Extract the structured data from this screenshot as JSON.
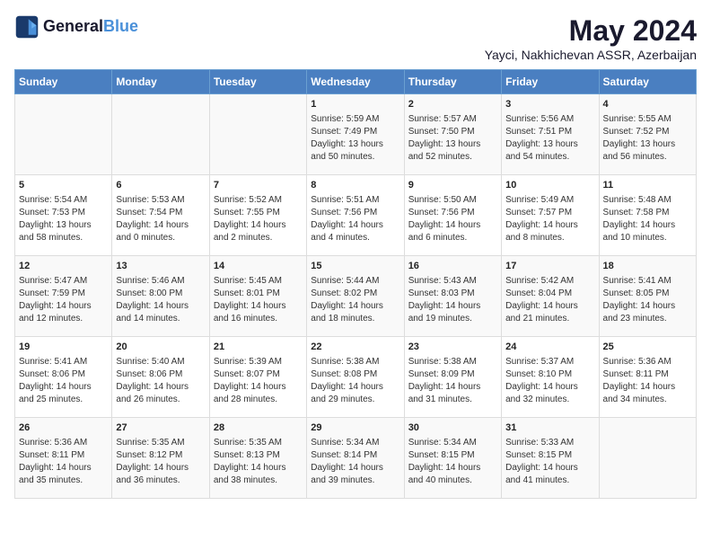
{
  "header": {
    "logo_line1": "General",
    "logo_line2": "Blue",
    "month_title": "May 2024",
    "location": "Yayci, Nakhichevan ASSR, Azerbaijan"
  },
  "days_of_week": [
    "Sunday",
    "Monday",
    "Tuesday",
    "Wednesday",
    "Thursday",
    "Friday",
    "Saturday"
  ],
  "weeks": [
    [
      {
        "day": "",
        "info": ""
      },
      {
        "day": "",
        "info": ""
      },
      {
        "day": "",
        "info": ""
      },
      {
        "day": "1",
        "info": "Sunrise: 5:59 AM\nSunset: 7:49 PM\nDaylight: 13 hours\nand 50 minutes."
      },
      {
        "day": "2",
        "info": "Sunrise: 5:57 AM\nSunset: 7:50 PM\nDaylight: 13 hours\nand 52 minutes."
      },
      {
        "day": "3",
        "info": "Sunrise: 5:56 AM\nSunset: 7:51 PM\nDaylight: 13 hours\nand 54 minutes."
      },
      {
        "day": "4",
        "info": "Sunrise: 5:55 AM\nSunset: 7:52 PM\nDaylight: 13 hours\nand 56 minutes."
      }
    ],
    [
      {
        "day": "5",
        "info": "Sunrise: 5:54 AM\nSunset: 7:53 PM\nDaylight: 13 hours\nand 58 minutes."
      },
      {
        "day": "6",
        "info": "Sunrise: 5:53 AM\nSunset: 7:54 PM\nDaylight: 14 hours\nand 0 minutes."
      },
      {
        "day": "7",
        "info": "Sunrise: 5:52 AM\nSunset: 7:55 PM\nDaylight: 14 hours\nand 2 minutes."
      },
      {
        "day": "8",
        "info": "Sunrise: 5:51 AM\nSunset: 7:56 PM\nDaylight: 14 hours\nand 4 minutes."
      },
      {
        "day": "9",
        "info": "Sunrise: 5:50 AM\nSunset: 7:56 PM\nDaylight: 14 hours\nand 6 minutes."
      },
      {
        "day": "10",
        "info": "Sunrise: 5:49 AM\nSunset: 7:57 PM\nDaylight: 14 hours\nand 8 minutes."
      },
      {
        "day": "11",
        "info": "Sunrise: 5:48 AM\nSunset: 7:58 PM\nDaylight: 14 hours\nand 10 minutes."
      }
    ],
    [
      {
        "day": "12",
        "info": "Sunrise: 5:47 AM\nSunset: 7:59 PM\nDaylight: 14 hours\nand 12 minutes."
      },
      {
        "day": "13",
        "info": "Sunrise: 5:46 AM\nSunset: 8:00 PM\nDaylight: 14 hours\nand 14 minutes."
      },
      {
        "day": "14",
        "info": "Sunrise: 5:45 AM\nSunset: 8:01 PM\nDaylight: 14 hours\nand 16 minutes."
      },
      {
        "day": "15",
        "info": "Sunrise: 5:44 AM\nSunset: 8:02 PM\nDaylight: 14 hours\nand 18 minutes."
      },
      {
        "day": "16",
        "info": "Sunrise: 5:43 AM\nSunset: 8:03 PM\nDaylight: 14 hours\nand 19 minutes."
      },
      {
        "day": "17",
        "info": "Sunrise: 5:42 AM\nSunset: 8:04 PM\nDaylight: 14 hours\nand 21 minutes."
      },
      {
        "day": "18",
        "info": "Sunrise: 5:41 AM\nSunset: 8:05 PM\nDaylight: 14 hours\nand 23 minutes."
      }
    ],
    [
      {
        "day": "19",
        "info": "Sunrise: 5:41 AM\nSunset: 8:06 PM\nDaylight: 14 hours\nand 25 minutes."
      },
      {
        "day": "20",
        "info": "Sunrise: 5:40 AM\nSunset: 8:06 PM\nDaylight: 14 hours\nand 26 minutes."
      },
      {
        "day": "21",
        "info": "Sunrise: 5:39 AM\nSunset: 8:07 PM\nDaylight: 14 hours\nand 28 minutes."
      },
      {
        "day": "22",
        "info": "Sunrise: 5:38 AM\nSunset: 8:08 PM\nDaylight: 14 hours\nand 29 minutes."
      },
      {
        "day": "23",
        "info": "Sunrise: 5:38 AM\nSunset: 8:09 PM\nDaylight: 14 hours\nand 31 minutes."
      },
      {
        "day": "24",
        "info": "Sunrise: 5:37 AM\nSunset: 8:10 PM\nDaylight: 14 hours\nand 32 minutes."
      },
      {
        "day": "25",
        "info": "Sunrise: 5:36 AM\nSunset: 8:11 PM\nDaylight: 14 hours\nand 34 minutes."
      }
    ],
    [
      {
        "day": "26",
        "info": "Sunrise: 5:36 AM\nSunset: 8:11 PM\nDaylight: 14 hours\nand 35 minutes."
      },
      {
        "day": "27",
        "info": "Sunrise: 5:35 AM\nSunset: 8:12 PM\nDaylight: 14 hours\nand 36 minutes."
      },
      {
        "day": "28",
        "info": "Sunrise: 5:35 AM\nSunset: 8:13 PM\nDaylight: 14 hours\nand 38 minutes."
      },
      {
        "day": "29",
        "info": "Sunrise: 5:34 AM\nSunset: 8:14 PM\nDaylight: 14 hours\nand 39 minutes."
      },
      {
        "day": "30",
        "info": "Sunrise: 5:34 AM\nSunset: 8:15 PM\nDaylight: 14 hours\nand 40 minutes."
      },
      {
        "day": "31",
        "info": "Sunrise: 5:33 AM\nSunset: 8:15 PM\nDaylight: 14 hours\nand 41 minutes."
      },
      {
        "day": "",
        "info": ""
      }
    ]
  ]
}
